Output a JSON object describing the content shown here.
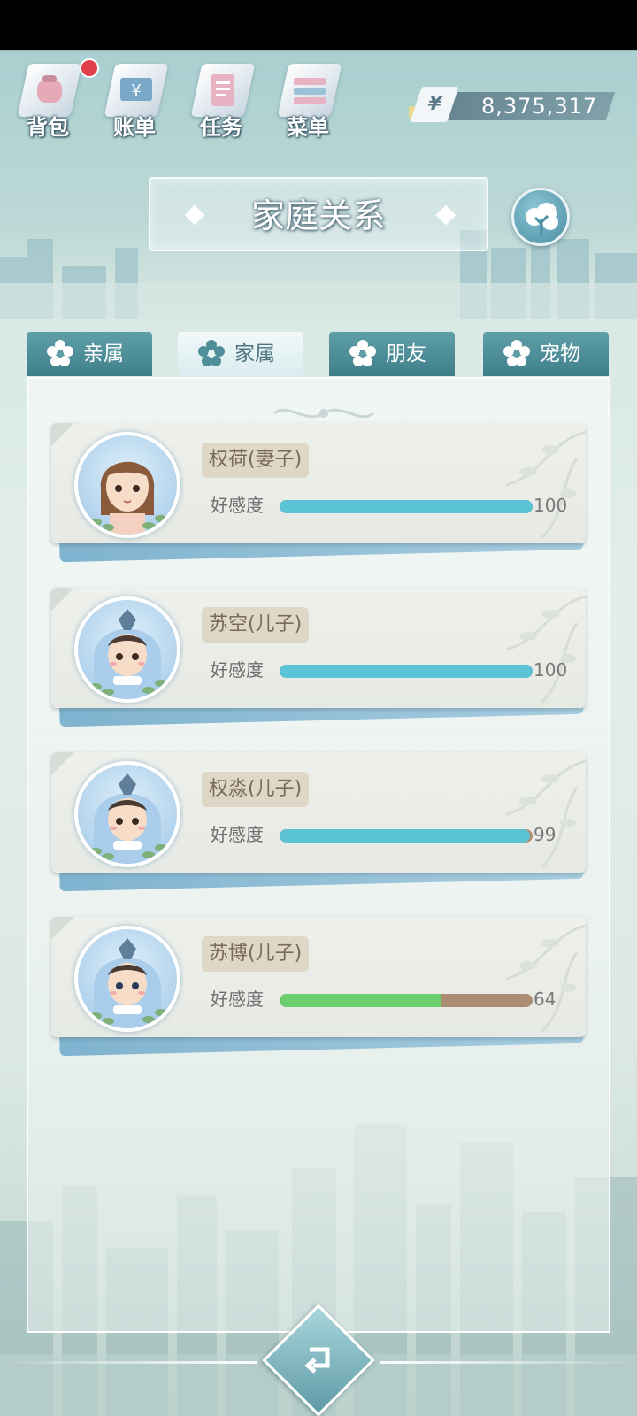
{
  "toolbar": {
    "items": [
      {
        "label": "背包",
        "icon": "backpack-icon",
        "has_notification": true
      },
      {
        "label": "账单",
        "icon": "bill-icon"
      },
      {
        "label": "任务",
        "icon": "task-icon"
      },
      {
        "label": "菜单",
        "icon": "menu-icon"
      }
    ],
    "currency_symbol": "¥",
    "money": "8,375,317"
  },
  "header": {
    "title": "家庭关系",
    "tree_icon": "family-tree-icon"
  },
  "tabs": [
    {
      "label": "亲属",
      "active": false
    },
    {
      "label": "家属",
      "active": true
    },
    {
      "label": "朋友",
      "active": false
    },
    {
      "label": "宠物",
      "active": false
    }
  ],
  "members": [
    {
      "name": "权荷(妻子)",
      "favor_label": "好感度",
      "favor": 100,
      "favor_text": "100",
      "avatar": "wife"
    },
    {
      "name": "苏空(儿子)",
      "favor_label": "好感度",
      "favor": 100,
      "favor_text": "100",
      "avatar": "son"
    },
    {
      "name": "权淼(儿子)",
      "favor_label": "好感度",
      "favor": 99,
      "favor_text": "99",
      "avatar": "son"
    },
    {
      "name": "苏博(儿子)",
      "favor_label": "好感度",
      "favor": 64,
      "favor_text": "64",
      "avatar": "son"
    }
  ],
  "colors": {
    "favor_full": "#5bc3d6",
    "favor_mid": "#6ccf6e",
    "favor_track": "#ab8d73",
    "tab_bg": "#4f8f99",
    "notification": "#e2404a"
  }
}
